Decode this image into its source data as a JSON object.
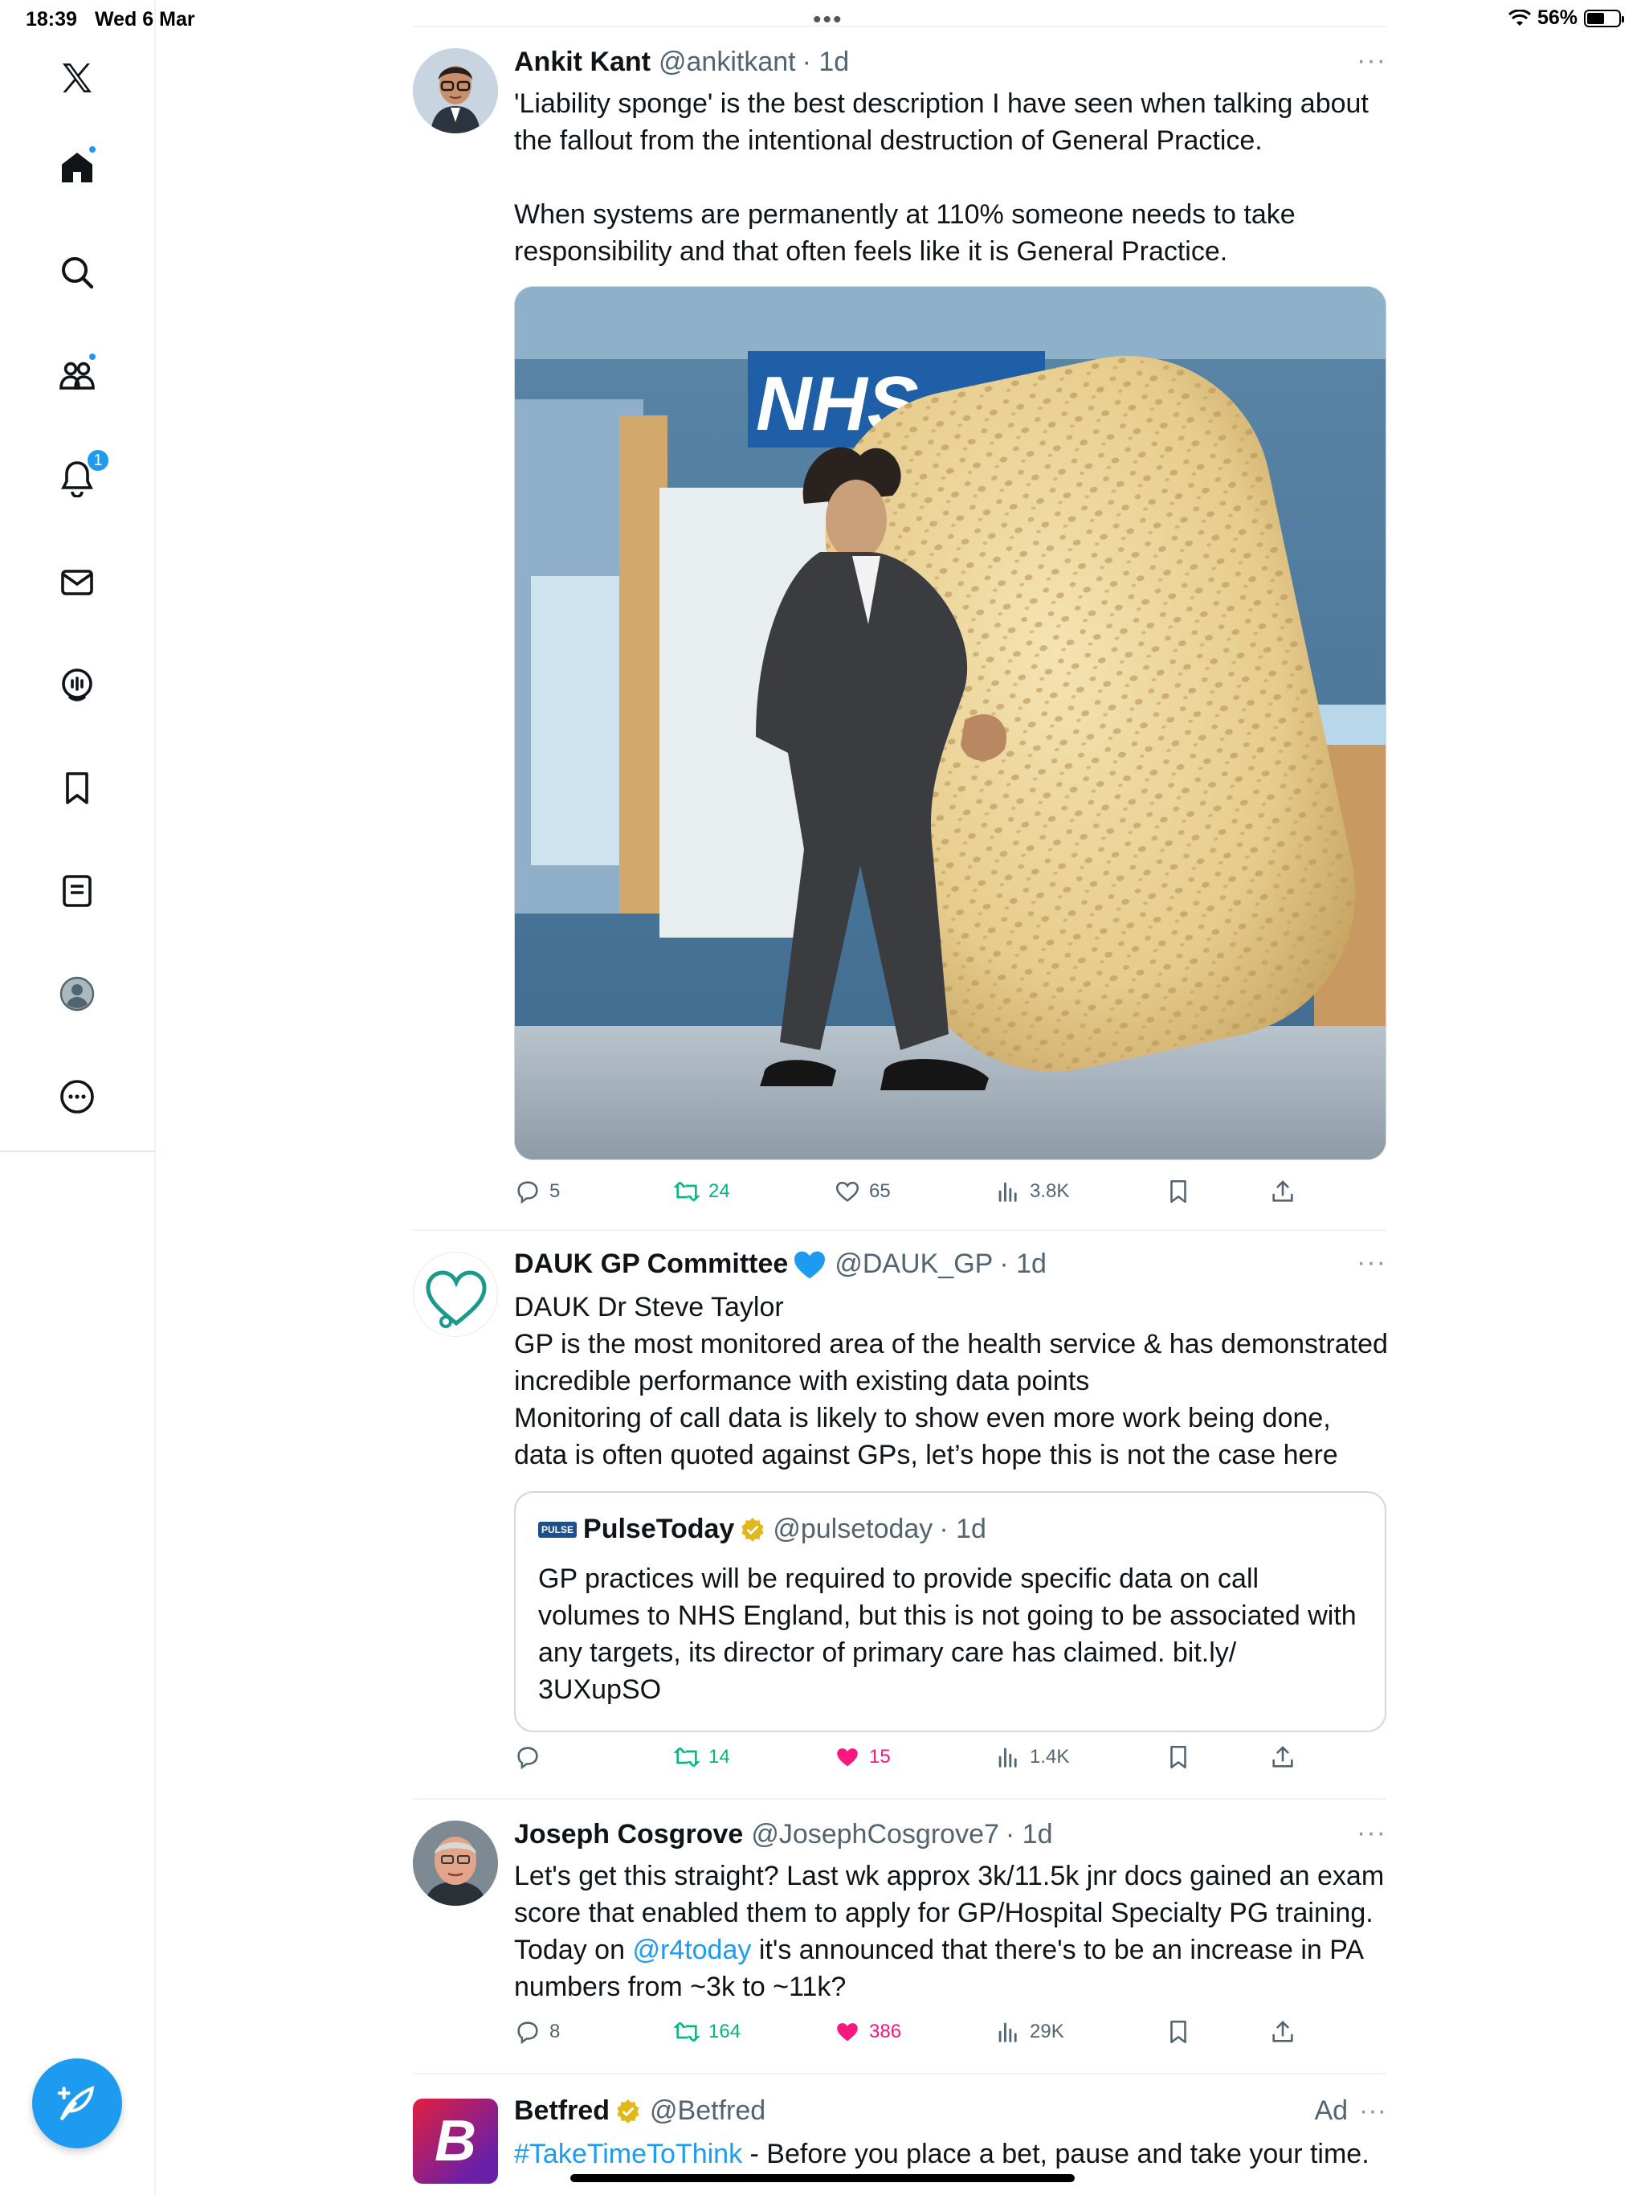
{
  "status_bar": {
    "time": "18:39",
    "date": "Wed 6 Mar",
    "battery": "56%",
    "battery_level": 0.56
  },
  "sidebar": {
    "items": [
      {
        "name": "x-logo-icon"
      },
      {
        "name": "home-icon"
      },
      {
        "name": "search-icon"
      },
      {
        "name": "communities-icon"
      },
      {
        "name": "notifications-icon",
        "badge": "1"
      },
      {
        "name": "messages-icon"
      },
      {
        "name": "spaces-icon"
      },
      {
        "name": "bookmarks-icon"
      },
      {
        "name": "lists-icon"
      },
      {
        "name": "profile-icon"
      },
      {
        "name": "more-icon"
      }
    ],
    "compose_icon": "compose-feather-icon"
  },
  "tweets": [
    {
      "name": "Ankit Kant",
      "handle": "@ankitkant",
      "time": "· 1d",
      "more": "···",
      "text_1": "'Liability sponge' is the best description I have seen when talking about the fallout from the intentional destruction of General Practice.",
      "text_2": "When systems are permanently at 110% someone needs to take responsibility and that often feels like it is General Practice.",
      "image_alt": "NHS",
      "replies": "5",
      "retweets": "24",
      "likes": "65",
      "views": "3.8K"
    },
    {
      "name": "DAUK GP Committee",
      "handle": "@DAUK_GP",
      "time": "· 1d",
      "more": "···",
      "text": "DAUK Dr Steve Taylor\nGP is the most monitored area of the health service & has demonstrated incredible performance with existing data points\nMonitoring of call data is likely to show even more work being done, data is often quoted against GPs, let’s hope this is not the case here",
      "quote": {
        "logo_text": "PULSE",
        "name": "PulseToday",
        "handle": "@pulsetoday",
        "time": "· 1d",
        "text": "GP practices will be required to provide specific data on call volumes to NHS England, but this is not going to be associated with any targets, its director of primary care has claimed. bit.ly/\n3UXupSO"
      },
      "replies": "",
      "retweets": "14",
      "likes": "15",
      "views": "1.4K"
    },
    {
      "name": "Joseph Cosgrove",
      "handle": "@JosephCosgrove7",
      "time": "· 1d",
      "more": "···",
      "text_a": "Let's get this straight? Last wk approx 3k/11.5k jnr docs gained an exam score that enabled them to apply for GP/Hospital Specialty PG training. Today on ",
      "mention": "@r4today",
      "text_b": " it's announced that there's to be an increase in PA numbers from ~3k to ~11k?",
      "replies": "8",
      "retweets": "164",
      "likes": "386",
      "views": "29K"
    },
    {
      "name": "Betfred",
      "handle": "@Betfred",
      "ad_label": "Ad",
      "more": "···",
      "logo_letter": "B",
      "hashtag": "#TakeTimeToThink",
      "text": " - Before you place a bet, pause and take your time."
    }
  ],
  "colors": {
    "accent": "#1d9bf0",
    "retweet": "#00ba7c",
    "like": "#f91880",
    "muted": "#536471",
    "border": "#eff3f4"
  }
}
